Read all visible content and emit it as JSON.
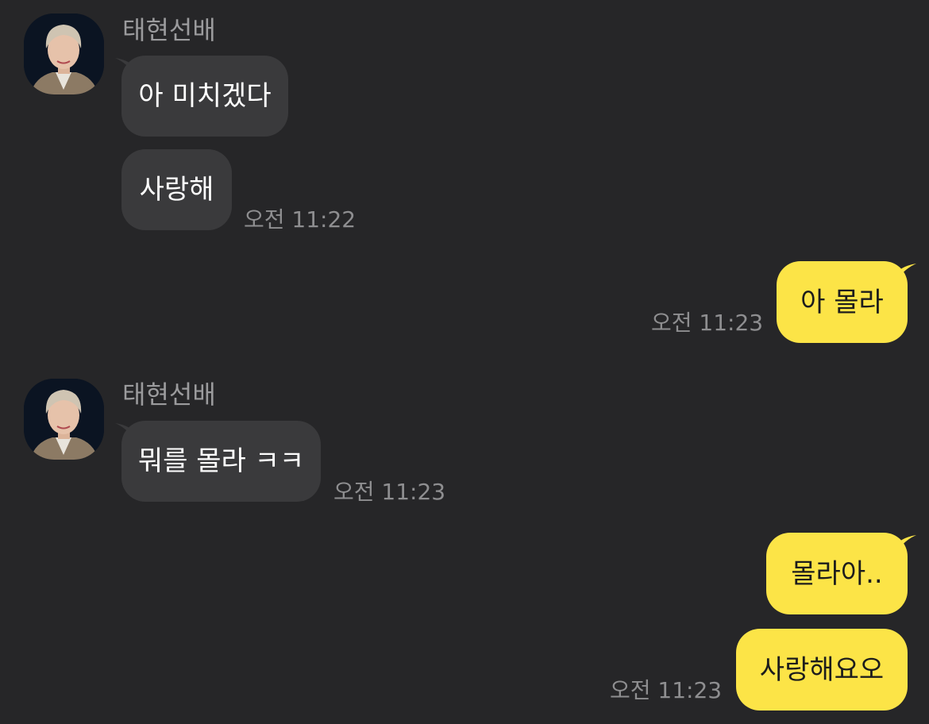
{
  "messages": [
    {
      "sender": "태현선배",
      "bubbles": [
        "아 미치겠다",
        "사랑해"
      ],
      "time": "오전 11:22"
    },
    {
      "bubbles": [
        "아 몰라"
      ],
      "time": "오전 11:23"
    },
    {
      "sender": "태현선배",
      "bubbles": [
        "뭐를 몰라 ㅋㅋ"
      ],
      "time": "오전 11:23"
    },
    {
      "bubbles": [
        "몰라아..",
        "사랑해요오"
      ],
      "time": "오전 11:23"
    }
  ],
  "colors": {
    "background": "#262628",
    "received_bubble": "#3a3a3c",
    "sent_bubble": "#fce447"
  }
}
